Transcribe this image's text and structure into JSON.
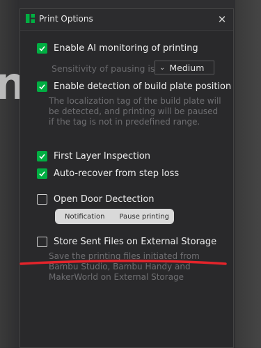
{
  "background": {
    "text": "nt"
  },
  "dialog": {
    "title": "Print Options"
  },
  "options": [
    {
      "label": "Enable AI monitoring of printing",
      "checked": true
    },
    {
      "label": "Enable detection of build plate position",
      "checked": true
    },
    {
      "label": "First Layer Inspection",
      "checked": true
    },
    {
      "label": "Auto-recover from step loss",
      "checked": true
    },
    {
      "label": "Open Door Dectection",
      "checked": false
    },
    {
      "label": "Store Sent Files on External Storage",
      "checked": false
    }
  ],
  "sensitivity": {
    "label": "Sensitivity of pausing is",
    "value": "Medium"
  },
  "build_plate_desc": "The localization tag of the build plate will be detected, and printing will be paused if the tag is not in predefined range.",
  "door_detection": {
    "options": [
      "Notification",
      "Pause printing"
    ]
  },
  "storage_desc": "Save the printing files initiated from Bambu Studio, Bambu Handy and MakerWorld on External Storage",
  "colors": {
    "accent": "#00ae42",
    "annotation": "#e3242b"
  },
  "icons": {
    "check": "check-icon",
    "close": "close-icon",
    "chevron": "chevron-down-icon",
    "logo": "bambu-logo-icon"
  }
}
